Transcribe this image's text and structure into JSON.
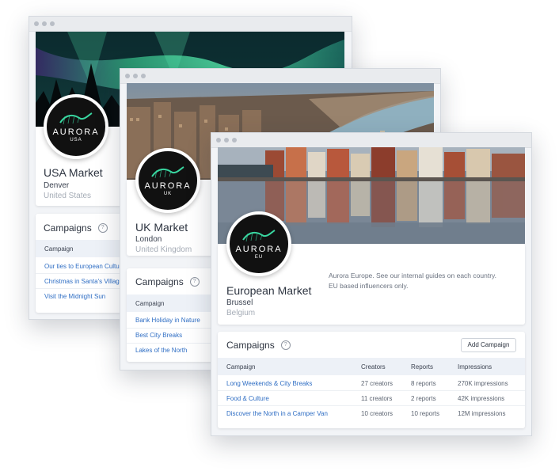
{
  "usa": {
    "logo": {
      "word": "AURORA",
      "sub": "USA"
    },
    "title": "USA Market",
    "city": "Denver",
    "country": "United States",
    "campaigns_title": "Campaigns",
    "help_glyph": "?",
    "col_campaign": "Campaign",
    "campaigns": [
      "Our ties to European Culture",
      "Christmas in Santa's Village",
      "Visit the Midnight Sun"
    ]
  },
  "uk": {
    "logo": {
      "word": "AURORA",
      "sub": "UK"
    },
    "title": "UK Market",
    "city": "London",
    "country": "United Kingdom",
    "campaigns_title": "Campaigns",
    "help_glyph": "?",
    "col_campaign": "Campaign",
    "campaigns": [
      "Bank Holiday in Nature",
      "Best City Breaks",
      "Lakes of the North"
    ]
  },
  "eu": {
    "logo": {
      "word": "AURORA",
      "sub": "EU"
    },
    "title": "European Market",
    "city": "Brussel",
    "country": "Belgium",
    "description": "Aurora Europe. See our internal guides on each country. EU based influencers only.",
    "campaigns_title": "Campaigns",
    "help_glyph": "?",
    "add_button": "Add Campaign",
    "columns": {
      "campaign": "Campaign",
      "creators": "Creators",
      "reports": "Reports",
      "impressions": "Impressions"
    },
    "rows": [
      {
        "campaign": "Long Weekends & City Breaks",
        "creators": "27 creators",
        "reports": "8 reports",
        "impressions": "270K impressions"
      },
      {
        "campaign": "Food & Culture",
        "creators": "11 creators",
        "reports": "2 reports",
        "impressions": "42K impressions"
      },
      {
        "campaign": "Discover the North in a Camper Van",
        "creators": "10 creators",
        "reports": "10 reports",
        "impressions": "12M impressions"
      }
    ]
  },
  "colors": {
    "link": "#2f6ec4",
    "aurora_green": "#39d6a0",
    "header_row": "#edf1f7"
  }
}
